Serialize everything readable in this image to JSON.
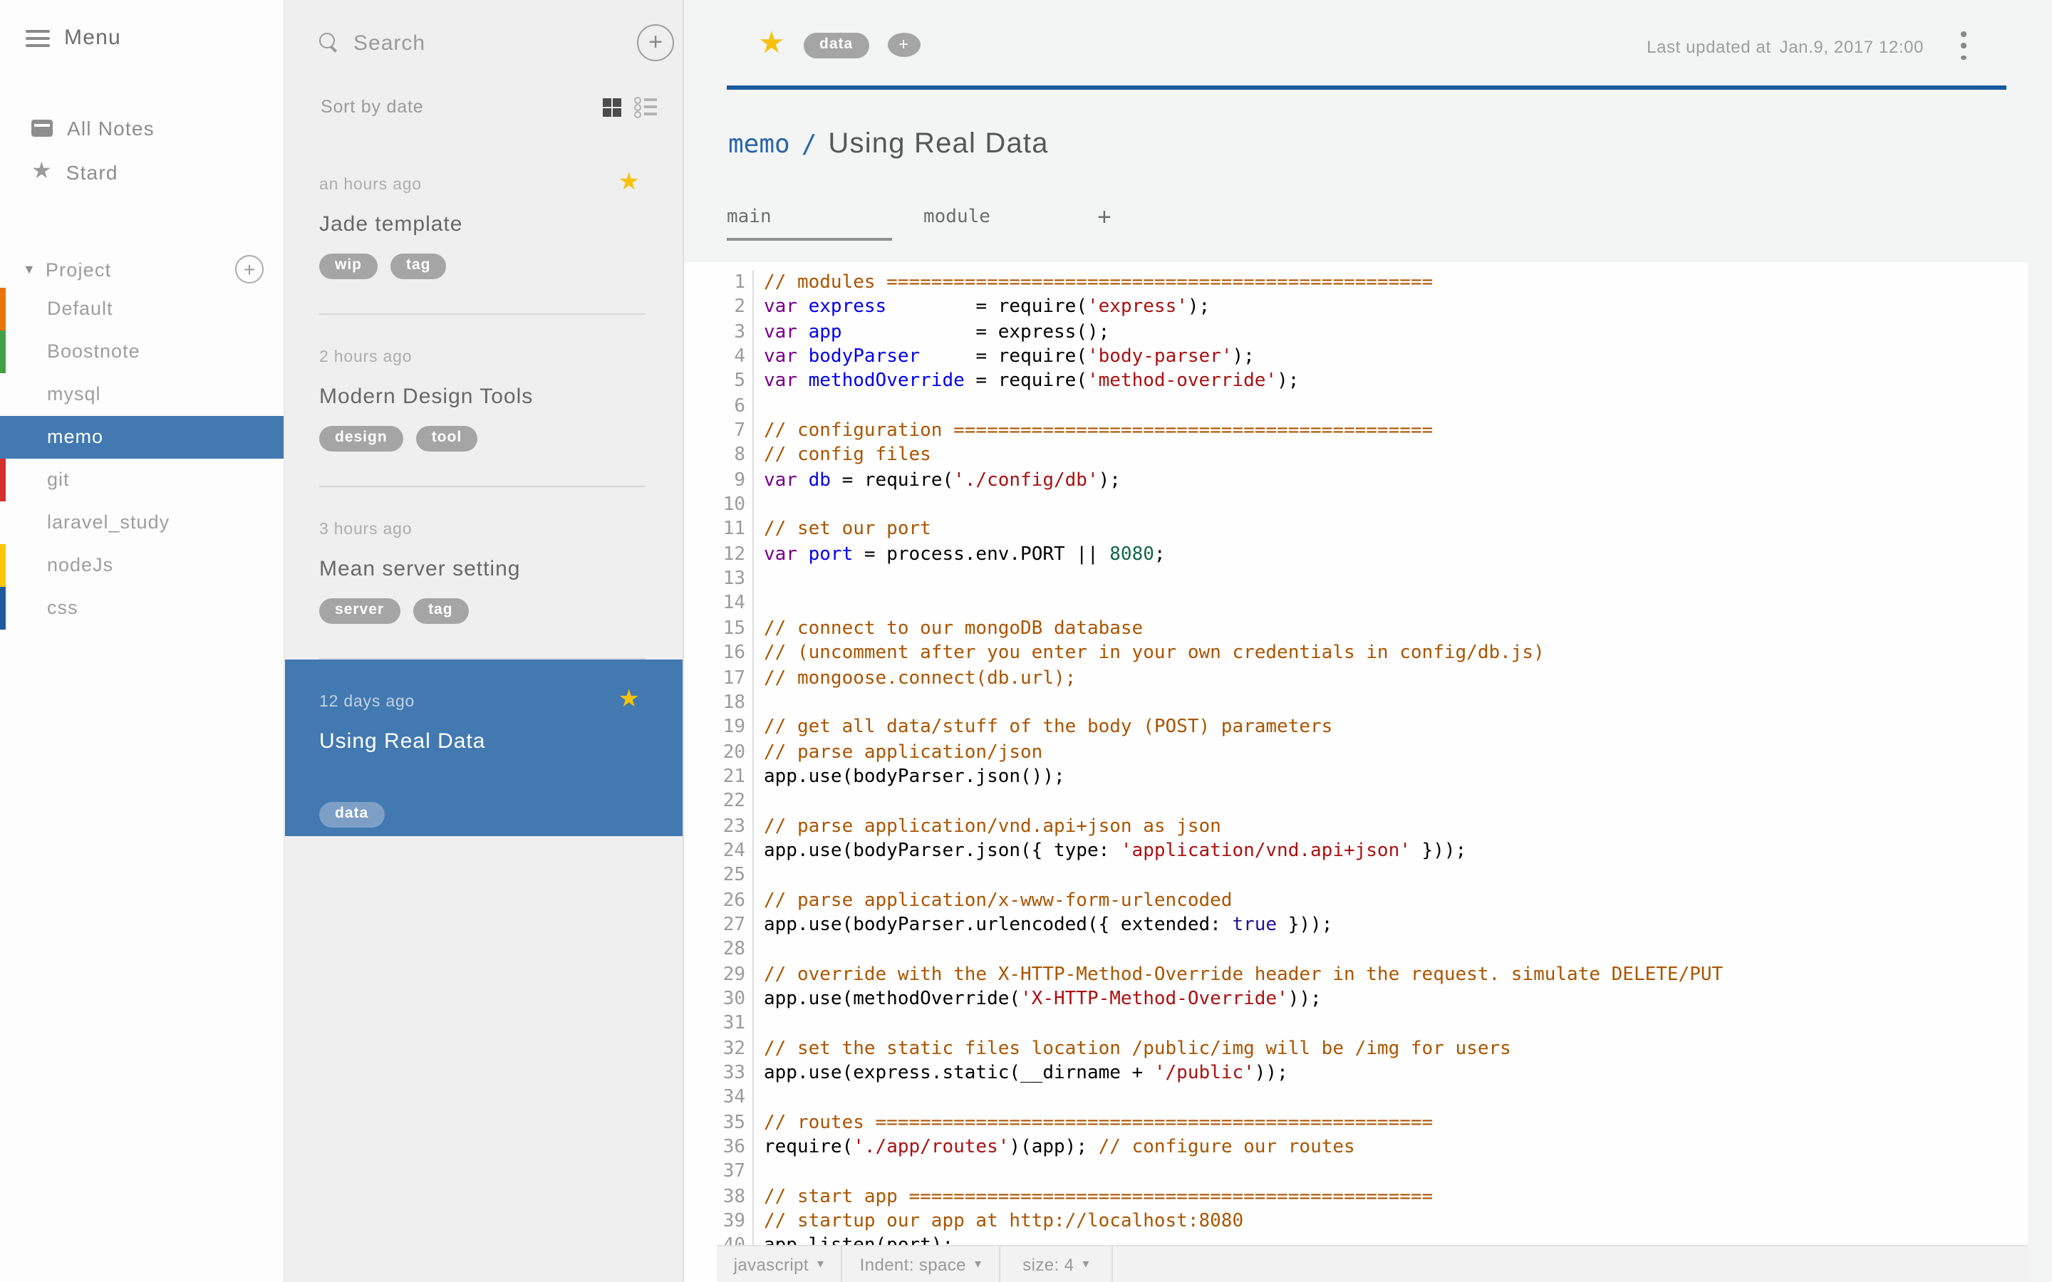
{
  "icons": {
    "star": "★",
    "plus": "+",
    "triangle_down": "▼",
    "caret_down": "▾"
  },
  "colors": {
    "accent_blue": "#4279b1",
    "header_rule_blue": "#1b5a9e",
    "star_gold": "#f6c20e",
    "tag_gray": "#a5a5a5",
    "selected_tag_blue": "#7e9fc5"
  },
  "sidebar": {
    "menu_label": "Menu",
    "nav": [
      {
        "label": "All Notes",
        "icon": "all-notes-icon"
      },
      {
        "label": "Stard",
        "icon": "star-icon"
      }
    ],
    "project": {
      "label": "Project"
    },
    "folders": [
      {
        "label": "Default",
        "color": "#e8740c",
        "selected": false
      },
      {
        "label": "Boostnote",
        "color": "#44a048",
        "selected": false
      },
      {
        "label": "mysql",
        "color": "",
        "selected": false
      },
      {
        "label": "memo",
        "color": "",
        "selected": true
      },
      {
        "label": "git",
        "color": "#d5312c",
        "selected": false
      },
      {
        "label": "laravel_study",
        "color": "",
        "selected": false
      },
      {
        "label": "nodeJs",
        "color": "#fdc500",
        "selected": false
      },
      {
        "label": "css",
        "color": "#1d5a9d",
        "selected": false
      }
    ]
  },
  "notelist": {
    "search_placeholder": "Search",
    "sort_label": "Sort by date",
    "notes": [
      {
        "time": "an hours ago",
        "title": "Jade template",
        "tags": [
          "wip",
          "tag"
        ],
        "starred": true,
        "selected": false
      },
      {
        "time": "2 hours ago",
        "title": "Modern Design Tools",
        "tags": [
          "design",
          "tool"
        ],
        "starred": false,
        "selected": false
      },
      {
        "time": "3 hours ago",
        "title": "Mean server setting",
        "tags": [
          "server",
          "tag"
        ],
        "starred": false,
        "selected": false
      },
      {
        "time": "12 days ago",
        "title": "Using Real Data",
        "tags": [
          "data"
        ],
        "starred": true,
        "selected": true
      }
    ]
  },
  "editor": {
    "starred": true,
    "tags": [
      "data"
    ],
    "last_updated_label": "Last updated at",
    "last_updated_value": "Jan.9, 2017 12:00",
    "breadcrumb_folder": "memo",
    "breadcrumb_separator": "/",
    "title": "Using Real Data",
    "tabs": [
      {
        "label": "main",
        "active": true
      },
      {
        "label": "module",
        "active": false
      }
    ],
    "statusbar": {
      "language": "javascript",
      "indent": "Indent: space",
      "size": "size: 4"
    }
  },
  "code": {
    "lines": [
      [
        [
          "c",
          "// modules ================================================="
        ]
      ],
      [
        [
          "k",
          "var"
        ],
        [
          "p",
          " "
        ],
        [
          "d",
          "express"
        ],
        [
          "p",
          "        = require("
        ],
        [
          "s",
          "'express'"
        ],
        [
          "p",
          ");"
        ]
      ],
      [
        [
          "k",
          "var"
        ],
        [
          "p",
          " "
        ],
        [
          "d",
          "app"
        ],
        [
          "p",
          "            = express();"
        ]
      ],
      [
        [
          "k",
          "var"
        ],
        [
          "p",
          " "
        ],
        [
          "d",
          "bodyParser"
        ],
        [
          "p",
          "     = require("
        ],
        [
          "s",
          "'body-parser'"
        ],
        [
          "p",
          ");"
        ]
      ],
      [
        [
          "k",
          "var"
        ],
        [
          "p",
          " "
        ],
        [
          "d",
          "methodOverride"
        ],
        [
          "p",
          " = require("
        ],
        [
          "s",
          "'method-override'"
        ],
        [
          "p",
          ");"
        ]
      ],
      [],
      [
        [
          "c",
          "// configuration ==========================================="
        ]
      ],
      [
        [
          "c",
          "// config files"
        ]
      ],
      [
        [
          "k",
          "var"
        ],
        [
          "p",
          " "
        ],
        [
          "d",
          "db"
        ],
        [
          "p",
          " = require("
        ],
        [
          "s",
          "'./config/db'"
        ],
        [
          "p",
          ");"
        ]
      ],
      [],
      [
        [
          "c",
          "// set our port"
        ]
      ],
      [
        [
          "k",
          "var"
        ],
        [
          "p",
          " "
        ],
        [
          "d",
          "port"
        ],
        [
          "p",
          " = process.env.PORT || "
        ],
        [
          "n",
          "8080"
        ],
        [
          "p",
          ";"
        ]
      ],
      [],
      [],
      [
        [
          "c",
          "// connect to our mongoDB database"
        ]
      ],
      [
        [
          "c",
          "// (uncomment after you enter in your own credentials in config/db.js)"
        ]
      ],
      [
        [
          "c",
          "// mongoose.connect(db.url);"
        ]
      ],
      [],
      [
        [
          "c",
          "// get all data/stuff of the body (POST) parameters"
        ]
      ],
      [
        [
          "c",
          "// parse application/json"
        ]
      ],
      [
        [
          "p",
          "app.use(bodyParser.json());"
        ]
      ],
      [],
      [
        [
          "c",
          "// parse application/vnd.api+json as json"
        ]
      ],
      [
        [
          "p",
          "app.use(bodyParser.json({ type: "
        ],
        [
          "s",
          "'application/vnd.api+json'"
        ],
        [
          "p",
          " }));"
        ]
      ],
      [],
      [
        [
          "c",
          "// parse application/x-www-form-urlencoded"
        ]
      ],
      [
        [
          "p",
          "app.use(bodyParser.urlencoded({ extended: "
        ],
        [
          "a",
          "true"
        ],
        [
          "p",
          " }));"
        ]
      ],
      [],
      [
        [
          "c",
          "// override with the X-HTTP-Method-Override header in the request. simulate DELETE/PUT"
        ]
      ],
      [
        [
          "p",
          "app.use(methodOverride("
        ],
        [
          "s",
          "'X-HTTP-Method-Override'"
        ],
        [
          "p",
          "));"
        ]
      ],
      [],
      [
        [
          "c",
          "// set the static files location /public/img will be /img for users"
        ]
      ],
      [
        [
          "p",
          "app.use(express.static(__dirname + "
        ],
        [
          "s",
          "'/public'"
        ],
        [
          "p",
          "));"
        ]
      ],
      [],
      [
        [
          "c",
          "// routes =================================================="
        ]
      ],
      [
        [
          "p",
          "require("
        ],
        [
          "s",
          "'./app/routes'"
        ],
        [
          "p",
          ")(app); "
        ],
        [
          "c",
          "// configure our routes"
        ]
      ],
      [],
      [
        [
          "c",
          "// start app ==============================================="
        ]
      ],
      [
        [
          "c",
          "// startup our app at http://localhost:8080"
        ]
      ],
      [
        [
          "p",
          "app.listen(port);"
        ]
      ]
    ]
  }
}
